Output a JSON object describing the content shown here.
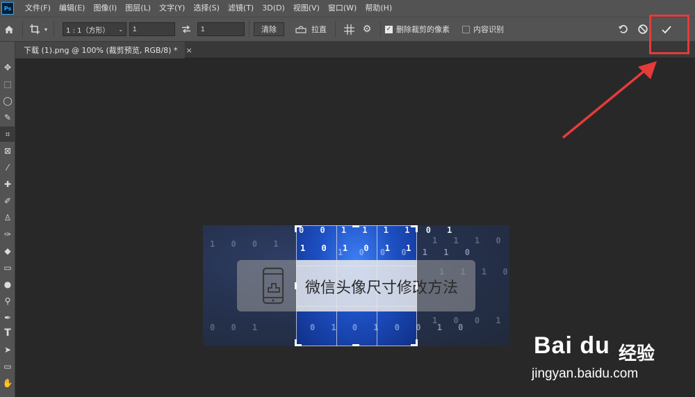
{
  "app": {
    "logo_text": "Ps",
    "menu": [
      "文件(F)",
      "编辑(E)",
      "图像(I)",
      "图层(L)",
      "文字(Y)",
      "选择(S)",
      "滤镜(T)",
      "3D(D)",
      "视图(V)",
      "窗口(W)",
      "帮助(H)"
    ]
  },
  "options": {
    "ratio_select": "1 : 1（方形）",
    "width_value": "1",
    "height_value": "1",
    "clear_label": "清除",
    "straighten_label": "拉直",
    "delete_cropped_label": "删除裁剪的像素",
    "delete_cropped_checked": true,
    "content_aware_label": "内容识别",
    "content_aware_checked": false
  },
  "document": {
    "tab_title": "下载 (1).png @ 100% (裁剪预览, RGB/8) *",
    "tab_close": "×"
  },
  "image": {
    "banner_text": "微信头像尺寸修改方法",
    "binary_rows": [
      {
        "text": "0 0 1 1 1 1 0 1",
        "class": "bright"
      },
      {
        "text": "1 0 1 0 1 1",
        "class": ""
      },
      {
        "text": "1 0 0 0 1 1 0",
        "class": ""
      },
      {
        "text": "1 0 1 0 0 1 0 0",
        "class": ""
      },
      {
        "text": "0 1 0 1 0 0 1 0",
        "class": ""
      }
    ]
  },
  "annotation": {
    "highlight_color": "#e53b3b"
  },
  "watermark": {
    "logo": "Bai du",
    "cn": "经验",
    "url": "jingyan.baidu.com"
  },
  "icons": {
    "home": "home-icon",
    "crop": "crop-icon",
    "swap": "swap-icon",
    "straighten": "straighten-icon",
    "grid": "grid-overlay-icon",
    "settings": "gear-icon",
    "reset": "reset-icon",
    "cancel": "cancel-icon",
    "commit": "checkmark-icon"
  }
}
